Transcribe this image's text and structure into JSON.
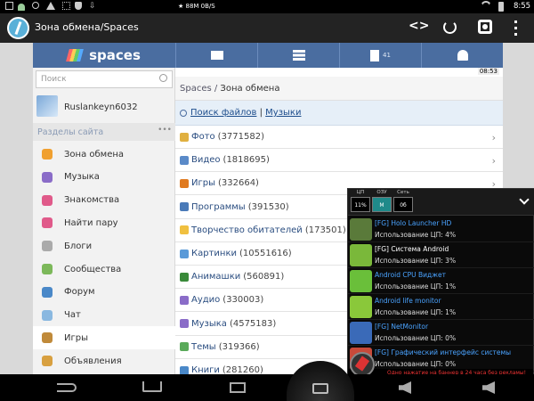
{
  "statusbar": {
    "center_text": "★ 88M 0B/S",
    "time": "8:55"
  },
  "actionbar": {
    "title": "Зона обмена/Spaces",
    "icons": [
      "code-icon",
      "refresh-icon",
      "settings-icon",
      "overflow-menu-icon"
    ]
  },
  "site": {
    "logo_text": "spaces",
    "nav_badge": "41",
    "clock": "08:53",
    "search_placeholder": "Поиск",
    "username": "Ruslankeyn6032",
    "sections_title": "Разделы сайта",
    "sections_more": "•••",
    "breadcrumb_root": "Spaces",
    "breadcrumb_sep": " / ",
    "breadcrumb_current": "Зона обмена",
    "search_files_link": "Поиск файлов",
    "search_sep": " | ",
    "music_link": "Музыки",
    "sidebar_items": [
      {
        "label": "Зона обмена",
        "icon": "grid-icon",
        "color": "#f0a030"
      },
      {
        "label": "Музыка",
        "icon": "music-note-icon",
        "color": "#8a6cc8"
      },
      {
        "label": "Знакомства",
        "icon": "heart-icon",
        "color": "#e05a8a"
      },
      {
        "label": "Найти пару",
        "icon": "broken-heart-icon",
        "color": "#e05a8a"
      },
      {
        "label": "Блоги",
        "icon": "pen-icon",
        "color": "#aaaaaa"
      },
      {
        "label": "Сообщества",
        "icon": "community-icon",
        "color": "#7cb85a"
      },
      {
        "label": "Форум",
        "icon": "forum-icon",
        "color": "#4a88c8"
      },
      {
        "label": "Чат",
        "icon": "chat-bubble-icon",
        "color": "#8ab8e0"
      },
      {
        "label": "Игры",
        "icon": "crossed-swords-icon",
        "color": "#c08a3a"
      },
      {
        "label": "Объявления",
        "icon": "ads-icon",
        "color": "#d8a040"
      }
    ],
    "rows": [
      {
        "label": "Фото",
        "count": "(3771582)",
        "icon": "photo-icon",
        "color": "#e0b040"
      },
      {
        "label": "Видео",
        "count": "(1818695)",
        "icon": "video-icon",
        "color": "#5a8ac8"
      },
      {
        "label": "Игры",
        "count": "(332664)",
        "icon": "game-icon",
        "color": "#e07a20"
      },
      {
        "label": "Программы",
        "count": "(391530)",
        "icon": "program-icon",
        "color": "#4a7ab8"
      },
      {
        "label": "Творчество обитателей",
        "count": "(173501)",
        "icon": "folder-icon",
        "color": "#f0c040"
      },
      {
        "label": "Картинки",
        "count": "(10551616)",
        "icon": "picture-icon",
        "color": "#5a9ad8"
      },
      {
        "label": "Анимашки",
        "count": "(560891)",
        "icon": "film-icon",
        "color": "#3a8a3a"
      },
      {
        "label": "Аудио",
        "count": "(330003)",
        "icon": "audio-note-icon",
        "color": "#8a6cc8"
      },
      {
        "label": "Музыка",
        "count": "(4575183)",
        "icon": "music-icon",
        "color": "#8a6cc8"
      },
      {
        "label": "Темы",
        "count": "(319366)",
        "icon": "theme-icon",
        "color": "#5aaa5a"
      },
      {
        "label": "Книги",
        "count": "(281260)",
        "icon": "book-icon",
        "color": "#4a88c8"
      }
    ]
  },
  "overlay": {
    "tabs": [
      {
        "label": "ЦП",
        "value": "11%"
      },
      {
        "label": "ОЗУ",
        "value": "M"
      },
      {
        "label": "Сеть",
        "value": "0б"
      }
    ],
    "processes": [
      {
        "name": "[FG] Holo Launcher HD",
        "cpu": "Использование ЦП: 4%",
        "name_color": "#4aa3ff",
        "icon": "holo-launcher-icon",
        "icon_color": "#5a7a3a"
      },
      {
        "name": "[FG] Система Android",
        "cpu": "Использование ЦП: 3%",
        "name_color": "#ffffff",
        "icon": "android-system-icon",
        "icon_color": "#7ab83a"
      },
      {
        "name": "Android CPU Виджет",
        "cpu": "Использование ЦП: 1%",
        "name_color": "#4aa3ff",
        "icon": "cpu-widget-icon",
        "icon_color": "#6abf3a"
      },
      {
        "name": "Android life monitor",
        "cpu": "Использование ЦП: 1%",
        "name_color": "#4aa3ff",
        "icon": "android-robot-icon",
        "icon_color": "#8ac83a"
      },
      {
        "name": "[FG] NetMonitor",
        "cpu": "Использование ЦП: 0%",
        "name_color": "#4aa3ff",
        "icon": "netmonitor-icon",
        "icon_color": "#3a6ab8"
      },
      {
        "name": "[FG] Графический интерфейс системы",
        "cpu": "Использование ЦП: 0%",
        "name_color": "#4aa3ff",
        "icon": "system-ui-icon",
        "icon_color": "#c84a3a"
      }
    ],
    "banner": "Одно нажатие на баннер в 24 часа без рекламы!"
  },
  "navbar": {
    "buttons": [
      "back-icon",
      "home-icon",
      "recent-apps-icon",
      "screenshot-icon",
      "volume-down-icon",
      "volume-up-icon"
    ]
  }
}
